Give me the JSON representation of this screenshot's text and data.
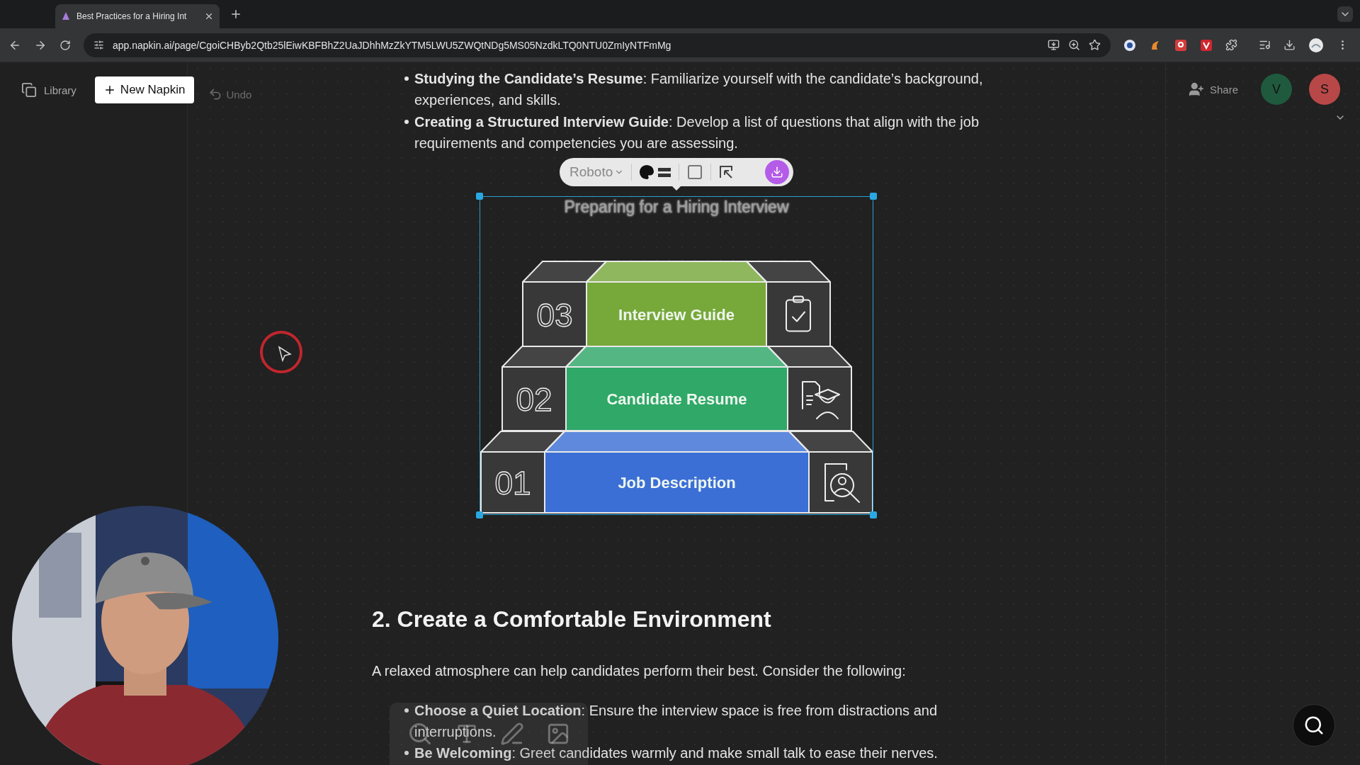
{
  "browser": {
    "tab": {
      "title": "Best Practices for a Hiring Int"
    },
    "url": "app.napkin.ai/page/CgoiCHByb2Qtb25lEiwKBFBhZ2UaJDhhMzZkYTM5LWU5ZWQtNDg5MS05NzdkLTQ0NTU0ZmIyNTFmMg"
  },
  "header": {
    "library": "Library",
    "new_button": "New Napkin",
    "undo": "Undo",
    "share": "Share",
    "avatars": [
      {
        "initial": "V",
        "color": "#1f5a3e"
      },
      {
        "initial": "S",
        "color": "#b84848"
      }
    ]
  },
  "document": {
    "bullets_top": [
      "**Studying the Candidate’s Resume**: Familiarize yourself with the candidate’s background, experiences, and skills.",
      "**Creating a Structured Interview Guide**: Develop a list of questions that align with the job requirements and competencies you are assessing."
    ],
    "visual": {
      "font": "Roboto",
      "title": "Preparing for a Hiring Interview",
      "steps": [
        {
          "number": "03",
          "label": "Interview Guide",
          "color": "#77a83a",
          "kind": "clipboard-check"
        },
        {
          "number": "02",
          "label": "Candidate Resume",
          "color": "#2fa868",
          "kind": "resume-graduate"
        },
        {
          "number": "01",
          "label": "Job Description",
          "color": "#3b6fd6",
          "kind": "person-search"
        }
      ]
    },
    "heading": "2. Create a Comfortable Environment",
    "paragraph": "A relaxed atmosphere can help candidates perform their best. Consider the following:",
    "bullets": [
      "**Choose a Quiet Location**: Ensure the interview space is free from distractions and interruptions.",
      "**Be Welcoming**: Greet candidates warmly and make small talk to ease their nerves."
    ]
  }
}
